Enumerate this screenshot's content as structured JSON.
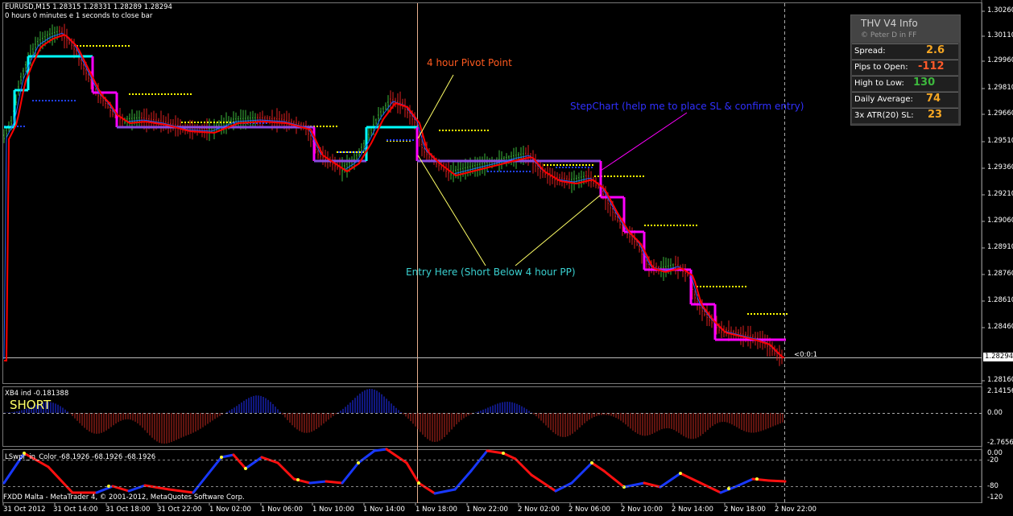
{
  "window": {
    "symbol_header": "EURUSD,M15  1.28315 1.28331 1.28289 1.28294",
    "timer": "0 hours 0 minutes e 1 seconds to close bar",
    "footer": "FXDD Malta - MetaTrader 4, © 2001-2012, MetaQuotes Software Corp."
  },
  "price_axis": {
    "labels": [
      "1.30260",
      "1.30110",
      "1.29960",
      "1.29810",
      "1.29660",
      "1.29510",
      "1.29360",
      "1.29210",
      "1.29060",
      "1.28910",
      "1.28760",
      "1.28610",
      "1.28460",
      "1.28160"
    ],
    "current_price": "1.28294",
    "bar_timer_text": "<0:0:1"
  },
  "time_axis": [
    "31 Oct 2012",
    "31 Oct 14:00",
    "31 Oct 18:00",
    "31 Oct 22:00",
    "1 Nov 02:00",
    "1 Nov 06:00",
    "1 Nov 10:00",
    "1 Nov 14:00",
    "1 Nov 18:00",
    "1 Nov 22:00",
    "2 Nov 02:00",
    "2 Nov 06:00",
    "2 Nov 10:00",
    "2 Nov 14:00",
    "2 Nov 18:00",
    "2 Nov 22:00"
  ],
  "annotations": {
    "pivot": "4 hour Pivot Point",
    "stepchart": "StepChart (help me to place SL & confirm entry)",
    "entry": "Entry Here (Short Below 4 hour PP)"
  },
  "info_panel": {
    "title": "THV  V4  Info",
    "subtitle": "© Peter D in FF",
    "rows": [
      {
        "label": "Spread:",
        "value": "2.6",
        "color": "#f5a623"
      },
      {
        "label": "Pips to Open:",
        "value": "-112",
        "color": "#ff5a2a"
      },
      {
        "label": "High to Low:",
        "value": "130",
        "color": "#3db83d"
      },
      {
        "label": "Daily Average:",
        "value": "74",
        "color": "#f5a623"
      },
      {
        "label": "3x ATR(20) SL:",
        "value": "23",
        "color": "#f5a623"
      }
    ]
  },
  "indicator1": {
    "name": "XB4 ind -0.181388",
    "signal": "SHORT",
    "axis": [
      "2.14156",
      "0.00",
      "-2.76563"
    ]
  },
  "indicator2": {
    "name": "LSwpr_in_Color -68.1926 -68.1926 -68.1926",
    "axis": [
      "0.00",
      "-20",
      "-80",
      "-120"
    ]
  },
  "colors": {
    "bull_candle": "#3db83d",
    "bear_candle": "#e02020",
    "step_up": "#00ffff",
    "step_down": "#ff00ff",
    "pivot_dots": "#ffff00",
    "ma": "#ff0000",
    "signal_text": "#ffff66"
  }
}
